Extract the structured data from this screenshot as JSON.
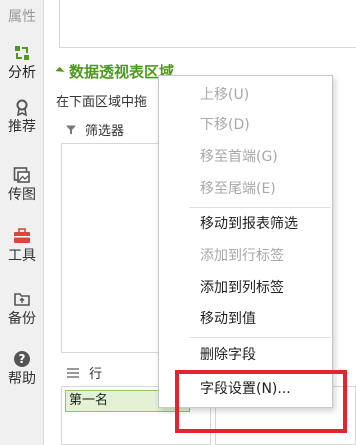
{
  "sidebar": {
    "items": [
      {
        "label": "属性",
        "icon": "properties-icon",
        "state": "dim"
      },
      {
        "label": "分析",
        "icon": "analysis-icon",
        "state": "active"
      },
      {
        "label": "推荐",
        "icon": "recommend-icon",
        "state": "normal"
      },
      {
        "label": "传图",
        "icon": "upload-image-icon",
        "state": "normal"
      },
      {
        "label": "工具",
        "icon": "toolbox-icon",
        "state": "normal"
      },
      {
        "label": "备份",
        "icon": "backup-icon",
        "state": "normal"
      },
      {
        "label": "帮助",
        "icon": "help-icon",
        "state": "normal"
      }
    ]
  },
  "panel": {
    "section_title": "数据透视表区域",
    "hint": "在下面区域中拖",
    "filter_label": "筛选器",
    "row_label": "行",
    "row_items": [
      "第一名"
    ]
  },
  "menu": {
    "items": [
      {
        "label": "上移(U)",
        "enabled": false
      },
      {
        "label": "下移(D)",
        "enabled": false
      },
      {
        "label": "移至首端(G)",
        "enabled": false
      },
      {
        "label": "移至尾端(E)",
        "enabled": false
      },
      {
        "label": "移动到报表筛选",
        "enabled": true
      },
      {
        "label": "添加到行标签",
        "enabled": false
      },
      {
        "label": "添加到列标签",
        "enabled": true
      },
      {
        "label": "移动到值",
        "enabled": true
      },
      {
        "label": "删除字段",
        "enabled": true
      },
      {
        "label": "字段设置(N)...",
        "enabled": true
      }
    ]
  },
  "colors": {
    "accent_green": "#4d9a1f",
    "highlight_red": "#e3232d",
    "toolbox_red": "#d9463f"
  }
}
